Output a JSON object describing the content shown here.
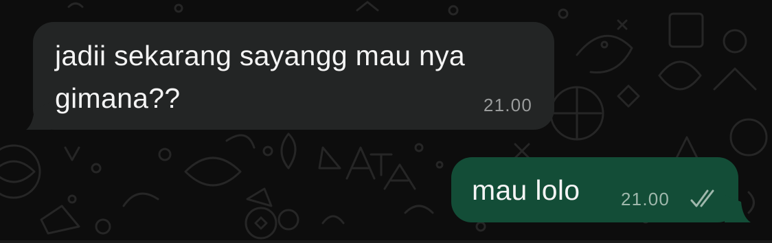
{
  "messages": [
    {
      "direction": "incoming",
      "text": "jadii sekarang sayangg mau nya\ngimana??",
      "time": "21.00"
    },
    {
      "direction": "outgoing",
      "text": "mau lolo",
      "time": "21.00",
      "status_icon": "double-check-icon"
    }
  ],
  "colors": {
    "background": "#0d0d0d",
    "incoming_bubble": "#232525",
    "outgoing_bubble": "#134d37",
    "doodle": "#2a2a2a"
  }
}
